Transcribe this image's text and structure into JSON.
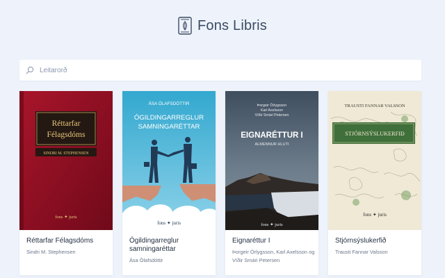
{
  "brand": {
    "name": "Fons Libris",
    "logo_icon": "book-logo-icon"
  },
  "search": {
    "placeholder": "Leitarorð",
    "value": "",
    "icon": "search-icon"
  },
  "colors": {
    "background": "#eef3fb",
    "accent": "#3a4a63"
  },
  "books": [
    {
      "title": "Réttarfar Félagsdóms",
      "author": "Sindri M. Stephensen",
      "cover": {
        "title_line1": "Réttarfar",
        "title_line2": "Félagsdóms",
        "author": "SINDRI M. STEPHENSEN",
        "publisher": "fons ✦ juris"
      }
    },
    {
      "title": "Ógildingarreglur samningaréttar",
      "author": "Ása Ólafsdóttir",
      "cover": {
        "author": "ÁSA ÓLAFSDÓTTIR",
        "title_line1": "ÓGILDINGARREGLUR",
        "title_line2": "SAMNINGARÉTTAR",
        "publisher": "fons ✦ juris"
      }
    },
    {
      "title": "Eignaréttur I",
      "author": "Þorgeir Örlygsson, Karl Axelsson og Víðir Smári Petersen",
      "author_line1": "Þorgeir Örlygsson, Karl Axelsson og",
      "author_line2": "Víðir Smári Petersen",
      "cover": {
        "authors": [
          "Þorgeir Örlygsson",
          "Karl Axelsson",
          "Víðir Smári Petersen"
        ],
        "title": "EIGNARÉTTUR I",
        "subtitle": "ALMENNUR HLUTI",
        "publisher": "fons ✦ juris"
      }
    },
    {
      "title": "Stjórnsýslukerfið",
      "author": "Trausti Fannar Valsson",
      "cover": {
        "author": "TRAUSTI FANNAR VALSSON",
        "title": "STJÓRNSÝSLUKERFIÐ",
        "publisher": "fons ✦ juris"
      }
    }
  ]
}
